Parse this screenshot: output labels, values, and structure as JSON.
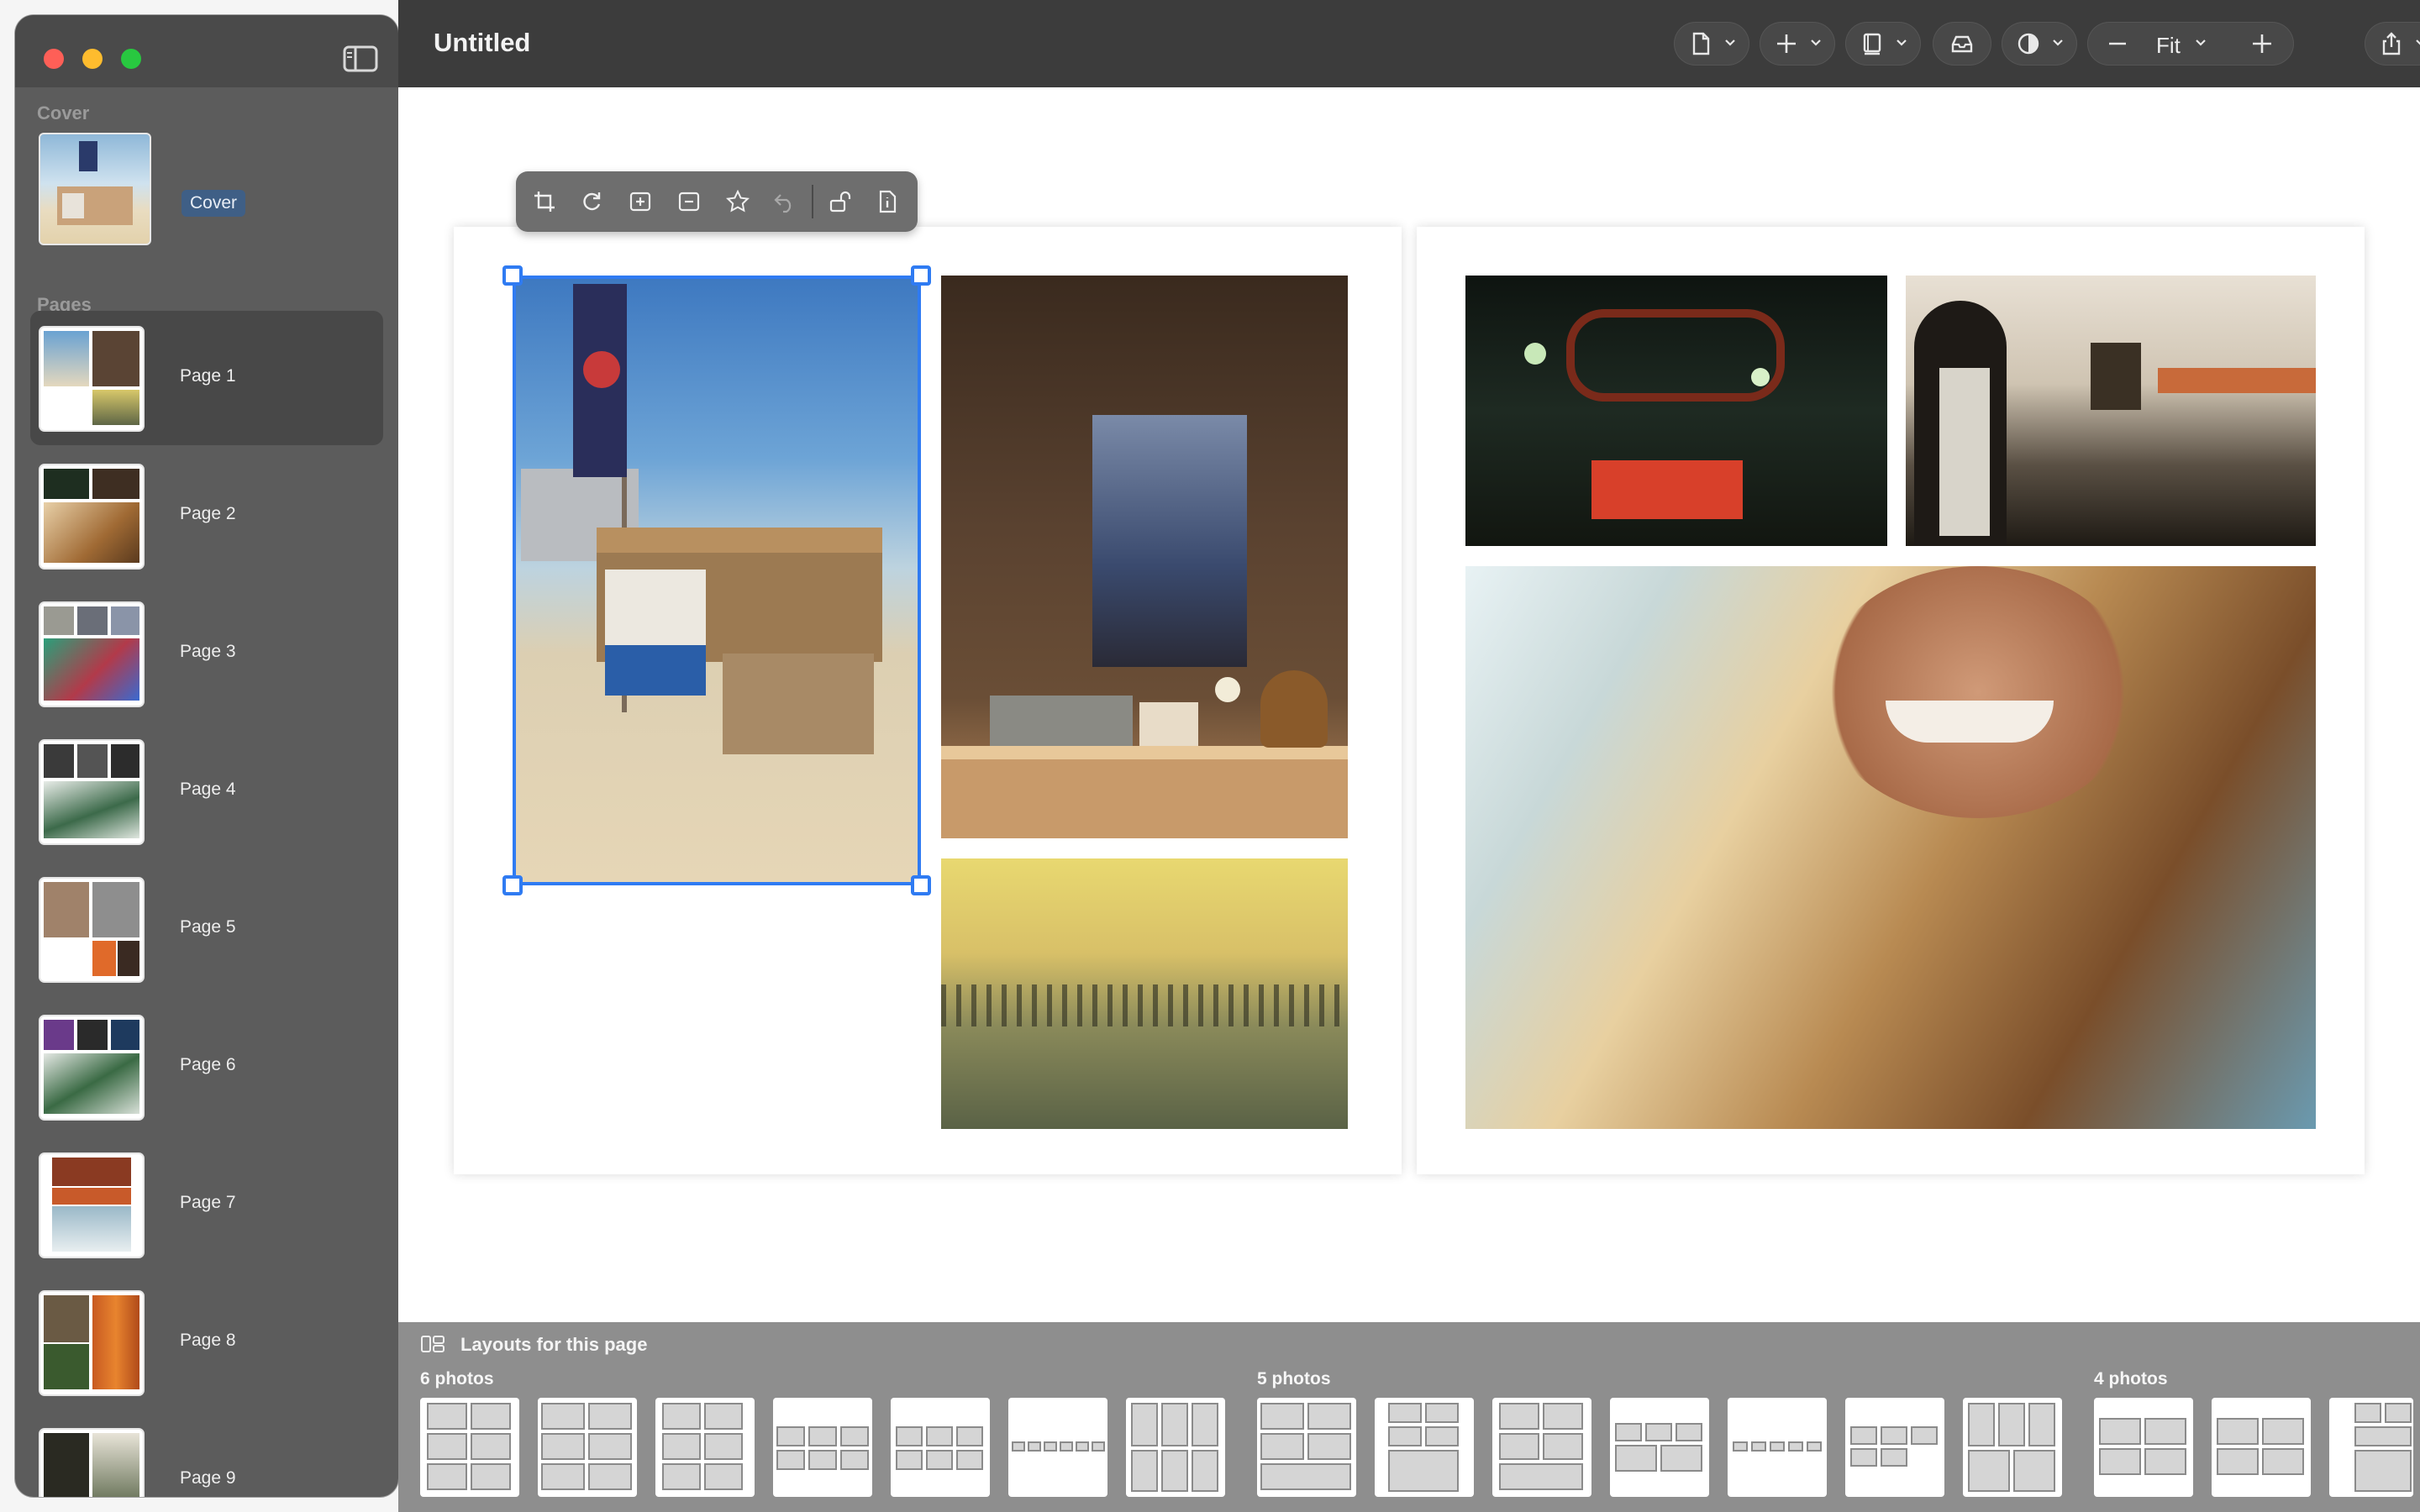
{
  "window": {
    "title": "Untitled"
  },
  "sidebar": {
    "cover_section": "Cover",
    "cover_label": "Cover",
    "pages_section": "Pages",
    "pages": [
      {
        "label": "Page 1"
      },
      {
        "label": "Page 2"
      },
      {
        "label": "Page 3"
      },
      {
        "label": "Page 4"
      },
      {
        "label": "Page 5"
      },
      {
        "label": "Page 6"
      },
      {
        "label": "Page 7"
      },
      {
        "label": "Page 8"
      },
      {
        "label": "Page 9"
      }
    ]
  },
  "toolbar": {
    "buttons": [
      "document-icon",
      "add-icon",
      "book-icon",
      "tray-icon",
      "contrast-icon",
      "zoom-control",
      "share-icon"
    ],
    "zoom_label": "Fit"
  },
  "photo_toolbar": {
    "icons": [
      "crop-icon",
      "rotate-icon",
      "zoom-in-icon",
      "zoom-out-icon",
      "star-icon",
      "undo-icon",
      "unlock-icon",
      "info-icon"
    ]
  },
  "layouts": {
    "title": "Layouts for this page",
    "groups": [
      {
        "label": "6 photos"
      },
      {
        "label": "5 photos"
      },
      {
        "label": "4 photos"
      }
    ]
  },
  "colors": {
    "selection": "#2f7bf2",
    "sidebar_bg": "#5c5c5c",
    "toolbar_bg": "#3c3c3c",
    "cover_highlight": "#3f5f86"
  }
}
